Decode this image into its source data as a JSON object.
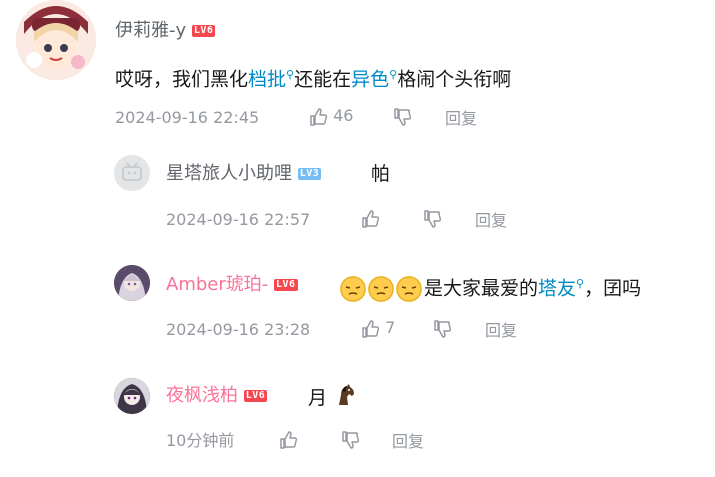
{
  "comments": [
    {
      "username": "伊莉雅-y",
      "level": "LV6",
      "content_parts": [
        {
          "text": "哎呀，我们黑化",
          "hl": false
        },
        {
          "text": "档批",
          "hl": true
        },
        {
          "text": "还能在",
          "hl": false
        },
        {
          "text": "异色",
          "hl": true
        },
        {
          "text": "格闹个头衔啊",
          "hl": false
        }
      ],
      "time": "2024-09-16 22:45",
      "likes": "46",
      "reply_label": "回复"
    },
    {
      "username": "星塔旅人小助哩",
      "level": "LV3",
      "content": "帕",
      "time": "2024-09-16 22:57",
      "likes": "",
      "reply_label": "回复"
    },
    {
      "username": "Amber琥珀-",
      "level": "LV6",
      "content_parts": [
        {
          "text": "是大家最爱的",
          "hl": false
        },
        {
          "text": "塔友",
          "hl": true
        },
        {
          "text": "，囝吗",
          "hl": false
        }
      ],
      "emoji_count": 3,
      "time": "2024-09-16 23:28",
      "likes": "7",
      "reply_label": "回复"
    },
    {
      "username": "夜枫浅柏",
      "level": "LV6",
      "content": "月",
      "time": "10分钟前",
      "likes": "",
      "reply_label": "回复"
    }
  ],
  "colors": {
    "name_default": "#61666d",
    "name_vip": "#fb7299",
    "level6": "#f7474e",
    "level3": "#74bef5",
    "link": "#008ac5",
    "meta": "#9499a0"
  }
}
